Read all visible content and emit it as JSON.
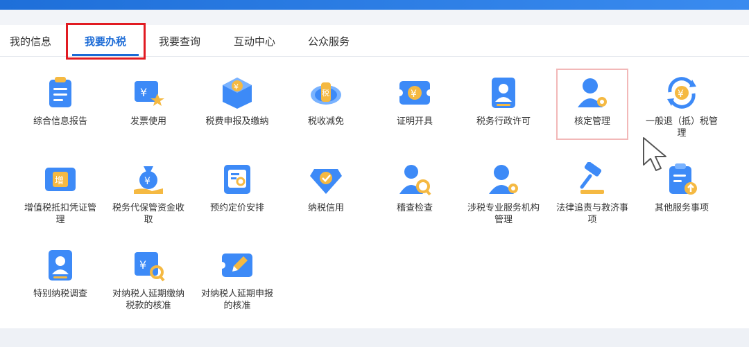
{
  "tabs": [
    {
      "label": "我的信息",
      "active": false
    },
    {
      "label": "我要办税",
      "active": true
    },
    {
      "label": "我要查询",
      "active": false
    },
    {
      "label": "互动中心",
      "active": false
    },
    {
      "label": "公众服务",
      "active": false
    }
  ],
  "items": [
    {
      "label": "综合信息报告",
      "icon": "clipboard-icon"
    },
    {
      "label": "发票使用",
      "icon": "invoice-star-icon"
    },
    {
      "label": "税费申报及缴纳",
      "icon": "tax-box-icon"
    },
    {
      "label": "税收减免",
      "icon": "tax-globe-icon"
    },
    {
      "label": "证明开具",
      "icon": "ticket-yuan-icon"
    },
    {
      "label": "税务行政许可",
      "icon": "user-card-icon"
    },
    {
      "label": "核定管理",
      "icon": "user-gear-icon"
    },
    {
      "label": "一般退（抵）税管理",
      "icon": "refund-cycle-icon"
    },
    {
      "label": "增值税抵扣凭证管理",
      "icon": "vat-ticket-icon"
    },
    {
      "label": "税务代保管资金收取",
      "icon": "money-bag-icon"
    },
    {
      "label": "预约定价安排",
      "icon": "document-search-icon"
    },
    {
      "label": "纳税信用",
      "icon": "credit-diamond-icon"
    },
    {
      "label": "稽查检查",
      "icon": "user-search-icon"
    },
    {
      "label": "涉税专业服务机构管理",
      "icon": "user-gear-icon"
    },
    {
      "label": "法律追责与救济事项",
      "icon": "gavel-icon"
    },
    {
      "label": "其他服务事项",
      "icon": "clipboard-upload-icon"
    },
    {
      "label": "特别纳税调查",
      "icon": "user-card-icon"
    },
    {
      "label": "对纳税人延期缴纳税款的核准",
      "icon": "invoice-search-icon"
    },
    {
      "label": "对纳税人延期申报的核准",
      "icon": "ticket-pen-icon"
    }
  ],
  "colors": {
    "accent": "#1a6ad6",
    "highlight_red": "#e11b22",
    "icon_blue": "#3d8af7",
    "icon_orange": "#f5b942"
  }
}
